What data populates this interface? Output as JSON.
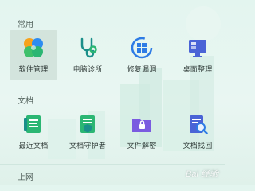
{
  "sections": [
    {
      "title": "常用",
      "items": [
        {
          "label": "软件管理",
          "icon": "clover-icon",
          "selected": true
        },
        {
          "label": "电脑诊所",
          "icon": "stethoscope-icon"
        },
        {
          "label": "修复漏洞",
          "icon": "windows-shield-icon"
        },
        {
          "label": "桌面整理",
          "icon": "monitor-icon"
        }
      ]
    },
    {
      "title": "文档",
      "items": [
        {
          "label": "最近文档",
          "icon": "recent-docs-icon"
        },
        {
          "label": "文档守护者",
          "icon": "doc-guard-icon"
        },
        {
          "label": "文件解密",
          "icon": "folder-lock-icon"
        },
        {
          "label": "文档找回",
          "icon": "doc-search-icon"
        }
      ]
    },
    {
      "title": "上网",
      "items": []
    }
  ],
  "watermark": "Bai 经验",
  "colors": {
    "green": "#2bb673",
    "teal": "#1a8f8a",
    "blue": "#2d7be5",
    "purple": "#4a63d6",
    "clover_orange": "#f7a21b",
    "clover_blue": "#2d8cf0",
    "clover_green": "#3ec06b"
  }
}
